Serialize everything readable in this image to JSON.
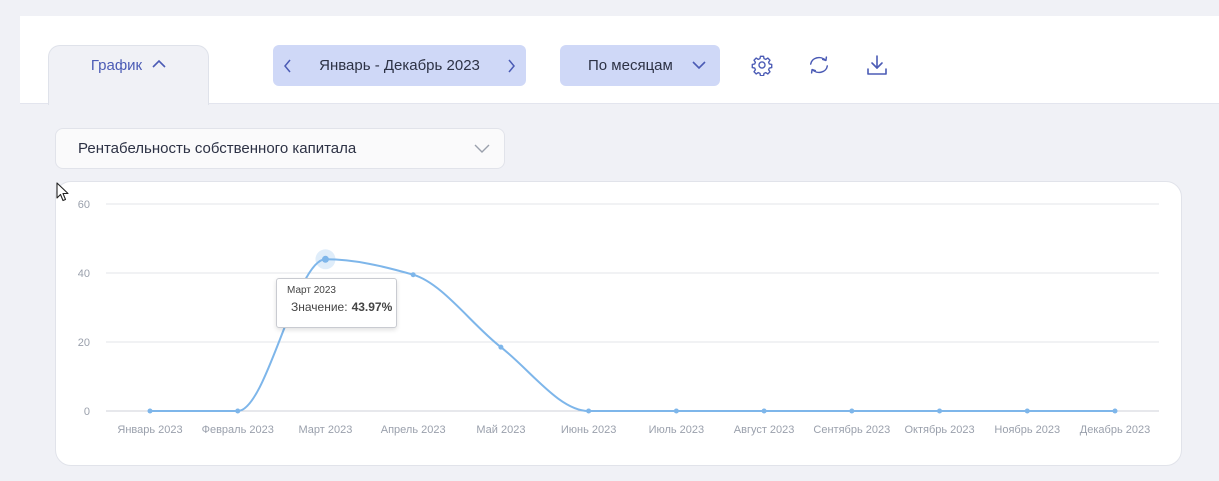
{
  "tabs": {
    "chart_label": "График"
  },
  "period": {
    "label": "Январь - Декабрь 2023"
  },
  "group_by": {
    "selected": "По месяцам"
  },
  "tools": [
    "settings-icon",
    "refresh-icon",
    "download-icon"
  ],
  "metric": {
    "selected": "Рентабельность собственного капитала"
  },
  "tooltip": {
    "title": "Март 2023",
    "label": "Значение:",
    "value": "43.97%"
  },
  "colors": {
    "accent": "#4b5bb5",
    "pill": "#cfd8f7",
    "line": "#7eb6ea",
    "grid": "#e3e4e8",
    "axis_text": "#9aa0ac"
  },
  "chart_data": {
    "type": "line",
    "categories": [
      "Январь 2023",
      "Февраль 2023",
      "Март 2023",
      "Апрель 2023",
      "Май 2023",
      "Июнь 2023",
      "Июль 2023",
      "Август 2023",
      "Сентябрь 2023",
      "Октябрь 2023",
      "Ноябрь 2023",
      "Декабрь 2023"
    ],
    "series": [
      {
        "values": [
          0,
          0,
          43.97,
          39.5,
          18.5,
          0,
          0,
          0,
          0,
          0,
          0,
          0
        ]
      }
    ],
    "ylim": [
      0,
      60
    ],
    "yticks": [
      0,
      20,
      40,
      60
    ],
    "grid": true,
    "highlight_index": 2
  }
}
